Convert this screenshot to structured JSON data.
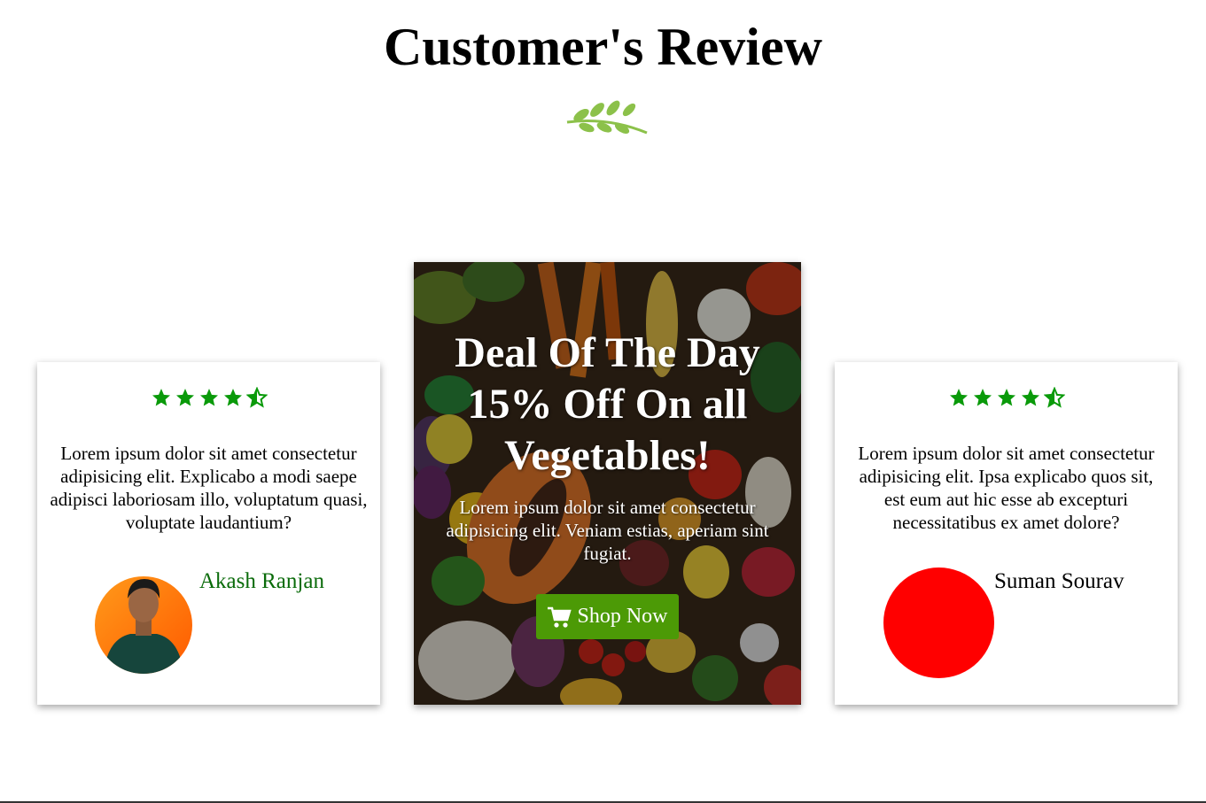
{
  "page": {
    "title": "Customer's Review"
  },
  "reviews": [
    {
      "rating": 4.5,
      "text": "Lorem ipsum dolor sit amet consectetur adipisicing elit. Explicabo a modi saepe adipisci laboriosam illo, voluptatum quasi, voluptate laudantium?",
      "name": "Akash Ranjan"
    },
    {
      "rating": 4.5,
      "text": "Lorem ipsum dolor sit amet consectetur adipisicing elit. Ipsa explicabo quos sit, est eum aut hic esse ab excepturi necessitatibus ex amet dolore?",
      "name": "Suman Sourav"
    }
  ],
  "deal": {
    "title": "Deal Of The Day 15% Off On all Vegetables!",
    "text": "Lorem ipsum dolor sit amet consectetur adipisicing elit. Veniam estias, aperiam sint fugiat.",
    "button_label": "Shop Now",
    "button_icon": "cart-icon"
  },
  "colors": {
    "star": "#0a9a0a",
    "button": "#4c9a06",
    "avatar_placeholder": "#ff0000",
    "left_name": "#0a6b0a"
  }
}
